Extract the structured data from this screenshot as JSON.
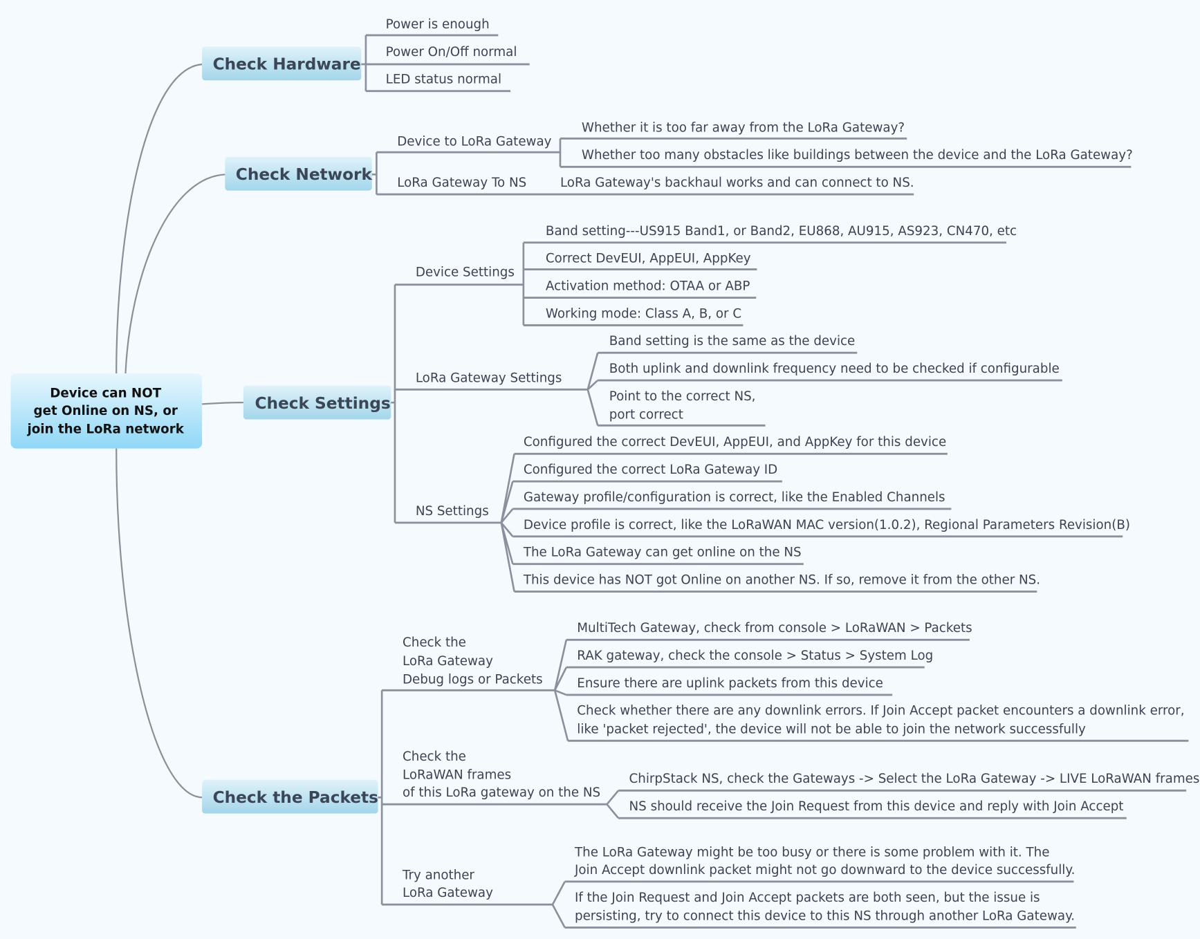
{
  "root": {
    "lines": [
      "Device can NOT",
      "get Online on NS, or",
      "join the LoRa network"
    ]
  },
  "colors": {
    "background": "#f5faff",
    "node_fill_top": "#dff1fa",
    "node_fill_bottom": "#a6d8ec",
    "root_fill_top": "#e6f5fd",
    "root_fill_bottom": "#93d9f6",
    "connector": "#8a909c",
    "text": "#3c4352"
  },
  "branches": {
    "hardware": {
      "label": "Check Hardware",
      "items": [
        "Power is enough",
        "Power On/Off normal",
        "LED status normal"
      ]
    },
    "network": {
      "label": "Check Network",
      "groups": [
        {
          "label": "Device to LoRa Gateway",
          "items": [
            "Whether it is too far away from the LoRa Gateway?",
            "Whether too many obstacles like buildings between the device and the LoRa Gateway?"
          ]
        },
        {
          "label": "LoRa Gateway To NS",
          "items": [
            "LoRa Gateway's backhaul works and can connect to NS."
          ]
        }
      ]
    },
    "settings": {
      "label": "Check Settings",
      "groups": [
        {
          "label": "Device Settings",
          "items": [
            "Band setting---US915 Band1, or Band2, EU868, AU915, AS923, CN470, etc",
            "Correct DevEUI, AppEUI, AppKey",
            "Activation method: OTAA or ABP",
            "Working mode: Class A, B, or C"
          ]
        },
        {
          "label": "LoRa Gateway Settings",
          "items": [
            "Band setting is the same as the device",
            "Both uplink and downlink frequency need to be checked if configurable",
            [
              "Point to the correct NS,",
              "port correct"
            ]
          ]
        },
        {
          "label": "NS Settings",
          "items": [
            "Configured the correct DevEUI, AppEUI, and AppKey for this device",
            "Configured the correct LoRa Gateway ID",
            "Gateway profile/configuration is correct, like the Enabled Channels",
            "Device profile is correct, like the LoRaWAN MAC version(1.0.2), Regional Parameters Revision(B)",
            "The LoRa Gateway can get online on the NS",
            "This device has NOT got Online on another NS. If so, remove it from the other NS."
          ]
        }
      ]
    },
    "packets": {
      "label": "Check the Packets",
      "groups": [
        {
          "label": [
            "Check the",
            "LoRa Gateway",
            "Debug logs or Packets"
          ],
          "items": [
            "MultiTech Gateway, check from console > LoRaWAN > Packets",
            "RAK gateway, check the console > Status > System Log",
            "Ensure there are uplink packets from this device",
            [
              "Check whether there are any downlink errors. If Join Accept packet encounters a downlink error,",
              "like 'packet rejected', the device will not be able to join the network successfully"
            ]
          ]
        },
        {
          "label": [
            "Check the",
            "LoRaWAN frames",
            "of this LoRa gateway on the NS"
          ],
          "items": [
            "ChirpStack NS, check the Gateways -> Select the LoRa Gateway -> LIVE LoRaWAN frames",
            "NS should receive the Join Request from this device and reply with Join Accept"
          ]
        },
        {
          "label": [
            "Try another",
            "LoRa Gateway"
          ],
          "items": [
            [
              "The LoRa Gateway might be too busy or there is some problem with it. The",
              "Join Accept downlink packet might not go downward to the device successfully."
            ],
            [
              "If the Join Request and Join Accept packets are both seen, but the issue is",
              "persisting, try to connect this device to this NS through another LoRa Gateway."
            ]
          ]
        }
      ]
    }
  }
}
